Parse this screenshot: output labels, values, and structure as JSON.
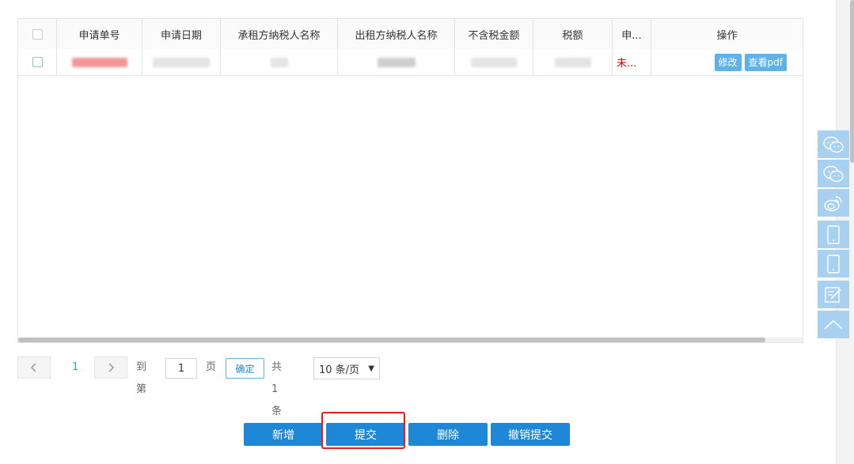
{
  "table": {
    "columns": [
      "申请单号",
      "申请日期",
      "承租方纳税人名称",
      "出租方纳税人名称",
      "不含税金额",
      "税额",
      "申...",
      "操作"
    ],
    "rows": [
      {
        "status": "未...",
        "actions": {
          "edit": "修改",
          "view_pdf": "查看pdf"
        }
      }
    ]
  },
  "pagination": {
    "prev_icon": "chevron-left-icon",
    "current_page": "1",
    "next_icon": "chevron-right-icon",
    "goto_label": "到第",
    "goto_value": "1",
    "page_unit": "页",
    "confirm_label": "确定",
    "total_text": "共 1 条",
    "page_size": "10 条/页"
  },
  "actions": {
    "add": "新增",
    "submit": "提交",
    "delete": "删除",
    "cancel_submit": "撤销提交"
  },
  "side_toolbar": {
    "items": [
      "wechat-icon",
      "wechat-icon",
      "weibo-icon",
      "tablet-icon",
      "tablet-icon",
      "edit-icon",
      "chevron-up-icon"
    ],
    "bg_color": "#a8d0f0"
  },
  "colors": {
    "primary": "#1e88d6",
    "op_button": "#5fb2e8",
    "highlight": "#e02020",
    "status": "#e60000"
  }
}
